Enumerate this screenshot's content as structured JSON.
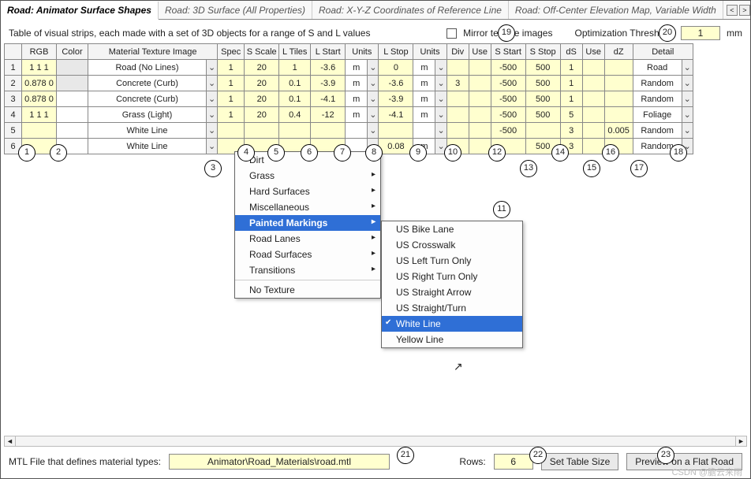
{
  "tabs": {
    "t0": "Road: Animator Surface Shapes",
    "t1": "Road: 3D Surface (All Properties)",
    "t2": "Road: X-Y-Z Coordinates of Reference Line",
    "t3": "Road: Off-Center Elevation Map, Variable Width",
    "scroller": {
      "left": "<",
      "right": ">"
    }
  },
  "descbar": {
    "text": "Table of visual strips, each made with a set of 3D objects for a range of S and L values",
    "mirror_label": "Mirror texture images",
    "opt_label": "Optimization Threshold:",
    "opt_value": "1",
    "opt_unit": "mm"
  },
  "columns": {
    "c0": "",
    "c1": "RGB",
    "c2": "Color",
    "c3": "Material Texture Image",
    "c4": "Spec",
    "c5": "S Scale",
    "c6": "L Tiles",
    "c7": "L Start",
    "c8": "Units",
    "c9": "L Stop",
    "c10": "Units",
    "c11": "Div",
    "c12": "Use",
    "c13": "S Start",
    "c14": "S Stop",
    "c15": "dS",
    "c16": "Use",
    "c17": "dZ",
    "c18": "Detail"
  },
  "rows": [
    {
      "n": "1",
      "rgb": "1 1 1",
      "color": "",
      "mat": "Road (No Lines)",
      "spec": "1",
      "sscale": "20",
      "ltiles": "1",
      "lstart": "-3.6",
      "u1": "m",
      "lstop": "0",
      "u2": "m",
      "div": "",
      "use1": "",
      "sstart": "-500",
      "sstop": "500",
      "ds": "1",
      "use2": "",
      "dz": "",
      "detail": "Road"
    },
    {
      "n": "2",
      "rgb": "0.878 0",
      "color": "",
      "mat": "Concrete (Curb)",
      "spec": "1",
      "sscale": "20",
      "ltiles": "0.1",
      "lstart": "-3.9",
      "u1": "m",
      "lstop": "-3.6",
      "u2": "m",
      "div": "3",
      "use1": "",
      "sstart": "-500",
      "sstop": "500",
      "ds": "1",
      "use2": "",
      "dz": "",
      "detail": "Random"
    },
    {
      "n": "3",
      "rgb": "0.878 0",
      "color": "",
      "mat": "Concrete (Curb)",
      "spec": "1",
      "sscale": "20",
      "ltiles": "0.1",
      "lstart": "-4.1",
      "u1": "m",
      "lstop": "-3.9",
      "u2": "m",
      "div": "",
      "use1": "",
      "sstart": "-500",
      "sstop": "500",
      "ds": "1",
      "use2": "",
      "dz": "",
      "detail": "Random"
    },
    {
      "n": "4",
      "rgb": "1 1 1",
      "color": "",
      "mat": "Grass (Light)",
      "spec": "1",
      "sscale": "20",
      "ltiles": "0.4",
      "lstart": "-12",
      "u1": "m",
      "lstop": "-4.1",
      "u2": "m",
      "div": "",
      "use1": "",
      "sstart": "-500",
      "sstop": "500",
      "ds": "5",
      "use2": "",
      "dz": "",
      "detail": "Foliage"
    },
    {
      "n": "5",
      "rgb": "",
      "color": "",
      "mat": "White Line",
      "spec": "",
      "sscale": "",
      "ltiles": "",
      "lstart": "",
      "u1": "",
      "lstop": "",
      "u2": "",
      "div": "",
      "use1": "",
      "sstart": "-500",
      "sstop": "",
      "ds": "3",
      "use2": "",
      "dz": "0.005",
      "detail": "Random"
    },
    {
      "n": "6",
      "rgb": "",
      "color": "",
      "mat": "White Line",
      "spec": "",
      "sscale": "",
      "ltiles": "",
      "lstart": "",
      "u1": "",
      "lstop": "0.08",
      "u2": "m",
      "div": "",
      "use1": "",
      "sstart": "",
      "sstop": "500",
      "ds": "3",
      "use2": "",
      "dz": "",
      "detail": "Random"
    }
  ],
  "menu1": {
    "i0": "Dirt",
    "i1": "Grass",
    "i2": "Hard Surfaces",
    "i3": "Miscellaneous",
    "i4": "Painted Markings",
    "i5": "Road Lanes",
    "i6": "Road Surfaces",
    "i7": "Transitions",
    "i8": "No Texture"
  },
  "menu2": {
    "i0": "US Bike Lane",
    "i1": "US Crosswalk",
    "i2": "US Left Turn Only",
    "i3": "US Right Turn Only",
    "i4": "US Straight Arrow",
    "i5": "US Straight/Turn",
    "i6": "White Line",
    "i7": "Yellow Line"
  },
  "bottom": {
    "mtl_label": "MTL File that defines material types:",
    "mtl_path": "Animator\\Road_Materials\\road.mtl",
    "rows_label": "Rows:",
    "rows_value": "6",
    "btn_setsize": "Set Table Size",
    "btn_preview": "Preview on a Flat Road"
  },
  "watermark": "CSDN @膽云来雨",
  "cursor_glyph": "↖"
}
